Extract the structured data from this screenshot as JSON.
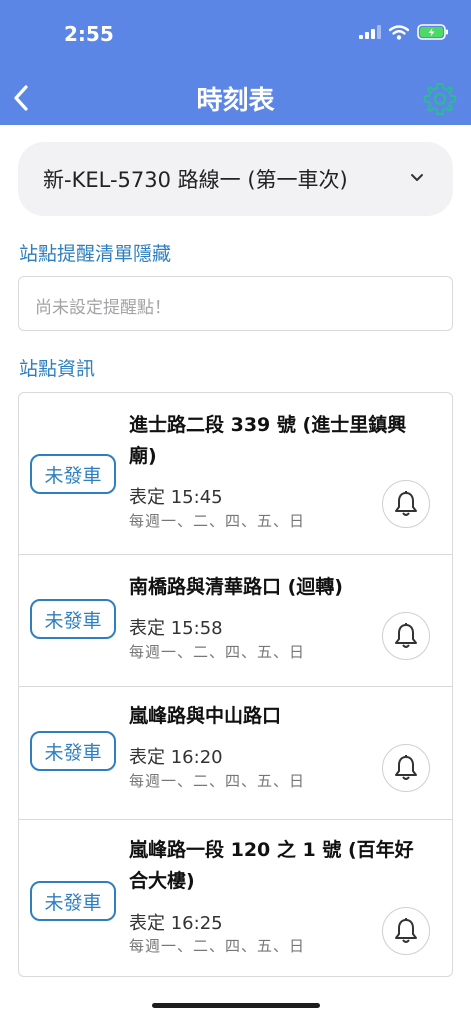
{
  "status_bar": {
    "time": "2:55"
  },
  "header": {
    "title": "時刻表"
  },
  "route_selector": {
    "label": "新-KEL-5730 路線一 (第一車次)"
  },
  "reminder": {
    "section_label": "站點提醒清單隱藏",
    "placeholder": "尚未設定提醒點！"
  },
  "stops_section": {
    "label": "站點資訊"
  },
  "stops": [
    {
      "name": "進士路二段 339 號 (進士里鎮興廟)",
      "status": "未發車",
      "time": "表定 15:45",
      "days": "每週一、二、四、五、日"
    },
    {
      "name": "南橋路與清華路口 (迴轉)",
      "status": "未發車",
      "time": "表定 15:58",
      "days": "每週一、二、四、五、日"
    },
    {
      "name": "嵐峰路與中山路口",
      "status": "未發車",
      "time": "表定 16:20",
      "days": "每週一、二、四、五、日"
    },
    {
      "name": "嵐峰路一段 120 之 1 號 (百年好合大樓)",
      "status": "未發車",
      "time": "表定 16:25",
      "days": "每週一、二、四、五、日"
    }
  ],
  "colors": {
    "header": "#5b86e5",
    "accent": "#2f7fc0",
    "settings_icon": "#2db89a"
  },
  "icons": [
    "back-icon",
    "settings-icon",
    "chevron-down-icon",
    "bell-icon",
    "signal-icon",
    "wifi-icon",
    "battery-icon"
  ]
}
